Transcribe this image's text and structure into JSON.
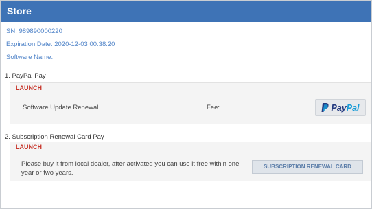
{
  "window": {
    "title": "Store"
  },
  "info": {
    "sn": "SN: 989890000220",
    "expiration": "Expiration Date: 2020-12-03 00:38:20",
    "software_name": "Software Name:"
  },
  "paypal_section": {
    "title": "1. PayPal Pay",
    "brand": "LAUNCH",
    "item": "Software Update Renewal",
    "fee_label": "Fee:",
    "button_part1": "Pay",
    "button_part2": "Pal"
  },
  "card_section": {
    "title": "2. Subscription Renewal Card Pay",
    "brand": "LAUNCH",
    "description_line1": "Please buy it from local dealer, after activated you can use it free within one",
    "description_line2": "year or two years.",
    "button_label": "SUBSCRIPTION RENEWAL CARD"
  },
  "colors": {
    "titlebar": "#3e73b6",
    "info_text": "#4f83c8",
    "brand_red": "#c8362b",
    "paypal_dark": "#253b80",
    "paypal_light": "#179bd7"
  },
  "icons": [
    "paypal-logo-icon"
  ]
}
